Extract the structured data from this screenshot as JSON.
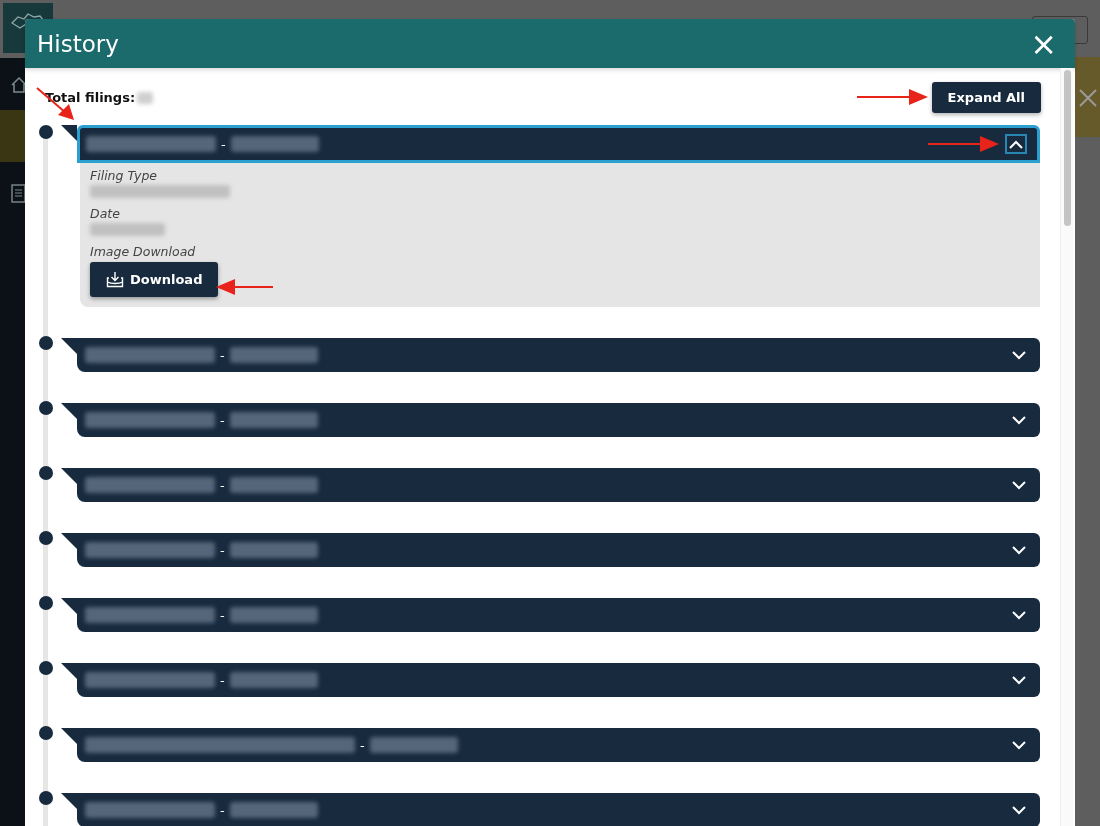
{
  "modal": {
    "title": "History",
    "close_icon": "×"
  },
  "total_filings": {
    "label": "Total filings:"
  },
  "expand_all": {
    "label": "Expand All"
  },
  "filings": [
    {
      "kind": "annual",
      "separator": "-",
      "expanded": true,
      "details": [
        {
          "label": "Filing Type",
          "kind": "blurred"
        },
        {
          "label": "Date",
          "kind": "blurred"
        },
        {
          "label": "Image Download",
          "kind": "download",
          "button": "Download"
        }
      ]
    },
    {
      "kind": "annual",
      "separator": "-",
      "expanded": false
    },
    {
      "kind": "annual",
      "separator": "-",
      "expanded": false
    },
    {
      "kind": "annual",
      "separator": "-",
      "expanded": false
    },
    {
      "kind": "annual",
      "separator": "-",
      "expanded": false
    },
    {
      "kind": "annual",
      "separator": "-",
      "expanded": false
    },
    {
      "kind": "annual",
      "separator": "-",
      "expanded": false
    },
    {
      "kind": "certificate",
      "separator": "-",
      "expanded": false
    },
    {
      "kind": "annual",
      "separator": "-",
      "expanded": false
    }
  ]
}
